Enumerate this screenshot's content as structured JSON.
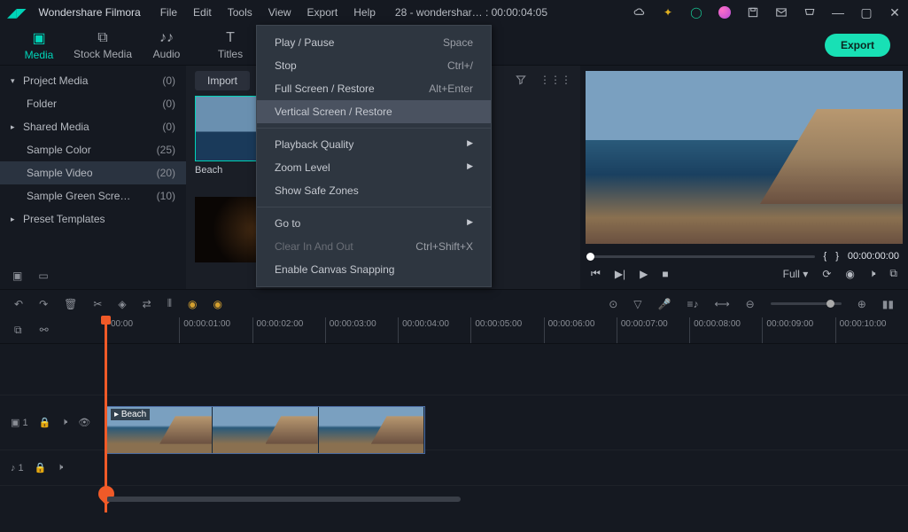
{
  "app": {
    "title": "Wondershare Filmora"
  },
  "menus": [
    "File",
    "Edit",
    "Tools",
    "View",
    "Export",
    "Help"
  ],
  "project": "28 - wondershar… : 00:00:04:05",
  "tabs": [
    {
      "label": "Media",
      "active": true
    },
    {
      "label": "Stock Media"
    },
    {
      "label": "Audio"
    },
    {
      "label": "Titles"
    }
  ],
  "export_label": "Export",
  "sidebar": [
    {
      "chev": "▾",
      "label": "Project Media",
      "count": "(0)"
    },
    {
      "indent": true,
      "label": "Folder",
      "count": "(0)"
    },
    {
      "chev": "▸",
      "label": "Shared Media",
      "count": "(0)"
    },
    {
      "indent": true,
      "label": "Sample Color",
      "count": "(25)"
    },
    {
      "indent": true,
      "label": "Sample Video",
      "count": "(20)",
      "sel": true
    },
    {
      "indent": true,
      "label": "Sample Green Scre…",
      "count": "(10)"
    },
    {
      "chev": "▸",
      "label": "Preset Templates"
    }
  ],
  "import_label": "Import",
  "thumb1_label": "Beach",
  "view_menu": [
    {
      "label": "Play / Pause",
      "sc": "Space"
    },
    {
      "label": "Stop",
      "sc": "Ctrl+/"
    },
    {
      "label": "Full Screen / Restore",
      "sc": "Alt+Enter"
    },
    {
      "label": "Vertical Screen / Restore",
      "hi": true
    },
    {
      "sep": true
    },
    {
      "label": "Playback Quality",
      "sub": true
    },
    {
      "label": "Zoom Level",
      "sub": true
    },
    {
      "label": "Show Safe Zones"
    },
    {
      "sep": true
    },
    {
      "label": "Go to",
      "sub": true
    },
    {
      "label": "Clear In And Out",
      "sc": "Ctrl+Shift+X",
      "dis": true
    },
    {
      "label": "Enable Canvas Snapping"
    }
  ],
  "preview": {
    "marker_in": "{",
    "marker_out": "}",
    "time": "00:00:00:00",
    "quality": "Full"
  },
  "ruler": [
    "00:00",
    "00:00:01:00",
    "00:00:02:00",
    "00:00:03:00",
    "00:00:04:00",
    "00:00:05:00",
    "00:00:06:00",
    "00:00:07:00",
    "00:00:08:00",
    "00:00:09:00",
    "00:00:10:00"
  ],
  "clip_label": "Beach",
  "track_v": "▣ 1",
  "track_a": "♪ 1"
}
